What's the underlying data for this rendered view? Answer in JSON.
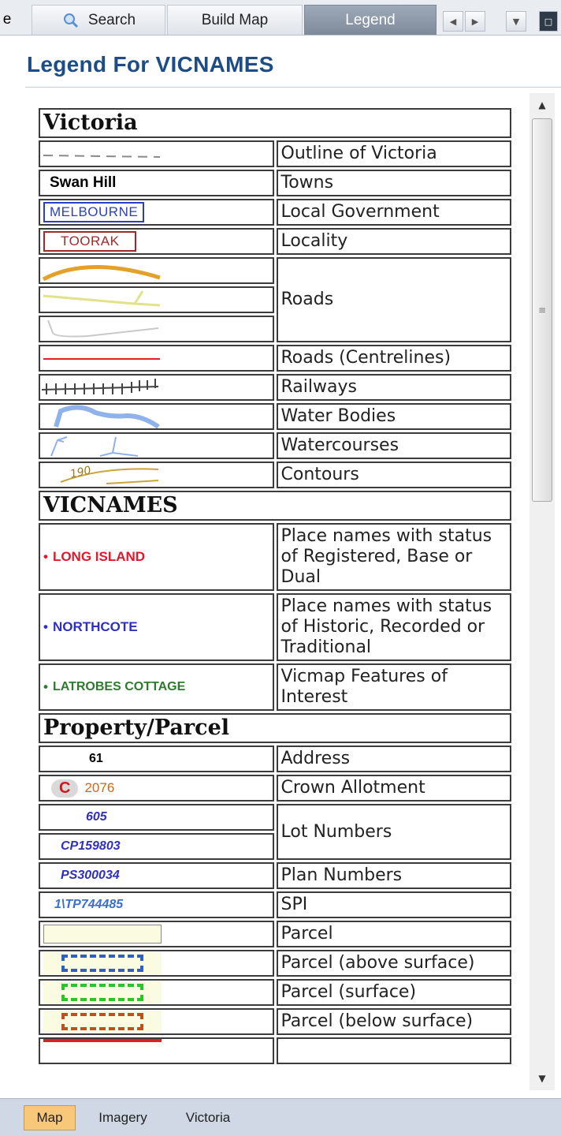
{
  "tabs": {
    "cut_label": "e",
    "search": "Search",
    "build_map": "Build Map",
    "legend": "Legend"
  },
  "heading": "Legend For VICNAMES",
  "legend": {
    "victoria": {
      "title": "Victoria",
      "outline": "Outline of Victoria",
      "towns_sample": "Swan Hill",
      "towns": "Towns",
      "lga_sample": "MELBOURNE",
      "lga": "Local Government",
      "locality_sample": "TOORAK",
      "locality": "Locality",
      "roads": "Roads",
      "centrelines": "Roads (Centrelines)",
      "railways": "Railways",
      "water_bodies": "Water Bodies",
      "watercourses": "Watercourses",
      "contour_sample": "190",
      "contours": "Contours"
    },
    "vicnames": {
      "title": "VICNAMES",
      "registered_sample": "LONG ISLAND",
      "registered": "Place names with status of Registered, Base or Dual",
      "historic_sample": "NORTHCOTE",
      "historic": "Place names with status of Historic, Recorded or Traditional",
      "features_sample": "LATROBES COTTAGE",
      "features": "Vicmap Features of Interest"
    },
    "property": {
      "title": "Property/Parcel",
      "address_sample": "61",
      "address": "Address",
      "crown_letter": "C",
      "crown_number": "2076",
      "crown": "Crown Allotment",
      "lot_sample_1": "605",
      "lot_sample_2": "CP159803",
      "lot": "Lot Numbers",
      "plan_sample": "PS300034",
      "plan": "Plan Numbers",
      "spi_sample": "1\\TP744485",
      "spi": "SPI",
      "parcel": "Parcel",
      "parcel_above": "Parcel (above surface)",
      "parcel_surface": "Parcel (surface)",
      "parcel_below": "Parcel (below surface)"
    }
  },
  "bottom_tabs": {
    "map": "Map",
    "imagery": "Imagery",
    "victoria": "Victoria"
  },
  "colors": {
    "heading": "#1d4d86",
    "lga": "#2b3fc4",
    "locality": "#a02a2a",
    "registered": "#e3162b",
    "historic": "#2f2fc0",
    "features": "#2e7a2e",
    "crown": "#d8641a"
  }
}
